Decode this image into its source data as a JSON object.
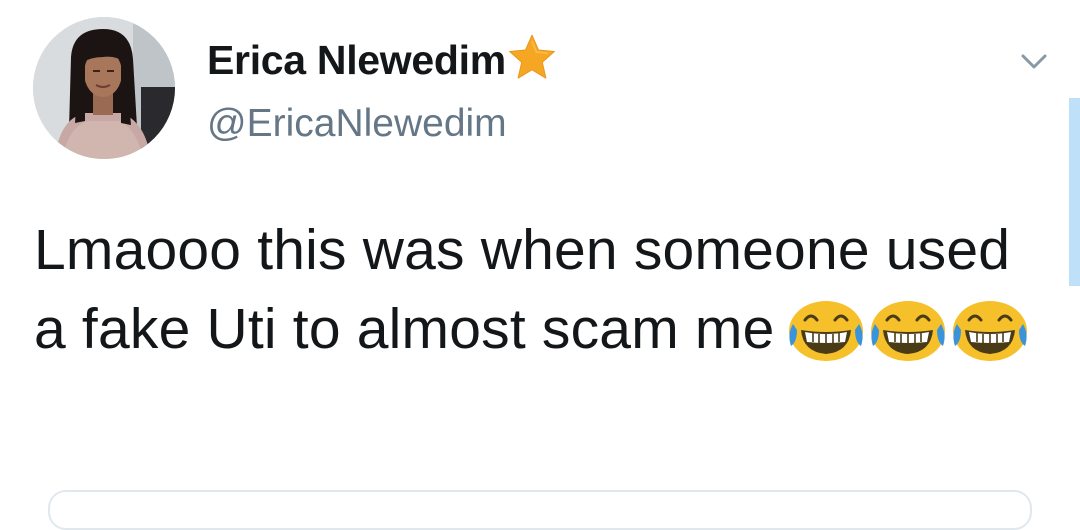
{
  "tweet": {
    "display_name": "Erica Nlewedim",
    "handle": "@EricaNlewedim",
    "text": "Lmaooo this was when someone used a fake Uti to almost scam me",
    "emoji": [
      "face-with-tears-of-joy",
      "face-with-tears-of-joy",
      "face-with-tears-of-joy"
    ]
  },
  "icons": {
    "badge": "star-icon",
    "menu": "chevron-down-icon"
  },
  "colors": {
    "text_primary": "#14171a",
    "text_secondary": "#657786",
    "star": "#f5a623",
    "emoji": "#f6c02b",
    "scrollbar": "#bfe0f9"
  }
}
